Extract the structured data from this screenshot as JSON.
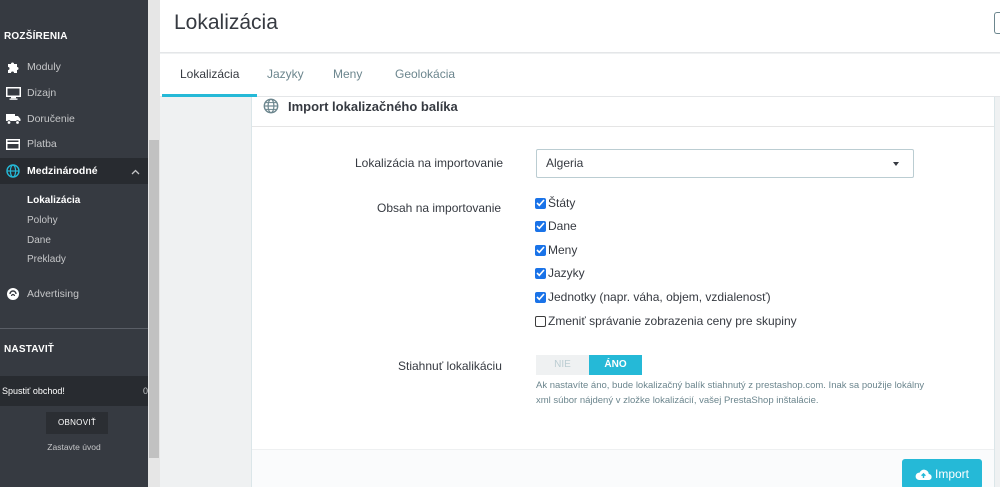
{
  "sidebar": {
    "section_extensions": "ROZŠÍRENIA",
    "items": [
      {
        "label": "Moduly",
        "icon": "puzzle-icon"
      },
      {
        "label": "Dizajn",
        "icon": "monitor-icon"
      },
      {
        "label": "Doručenie",
        "icon": "truck-icon"
      },
      {
        "label": "Platba",
        "icon": "credit-card-icon"
      },
      {
        "label": "Medzinárodné",
        "icon": "globe-icon"
      },
      {
        "label": "Advertising",
        "icon": "advertising-icon"
      }
    ],
    "subitems": [
      "Lokalizácia",
      "Polohy",
      "Dane",
      "Preklady"
    ],
    "section_settings": "NASTAVIŤ",
    "shop_label": "Spustiť obchod!",
    "shop_count": "0",
    "refresh_button": "OBNOVIŤ",
    "stop_tour": "Zastavte úvod"
  },
  "header": {
    "title": "Lokalizácia"
  },
  "tabs": [
    "Lokalizácia",
    "Jazyky",
    "Meny",
    "Geolokácia"
  ],
  "panel": {
    "title": "Import lokalizačného balíka",
    "localization_label": "Lokalizácia na importovanie",
    "localization_value": "Algeria",
    "content_label": "Obsah na importovanie",
    "content_options": [
      {
        "label": "Štáty",
        "checked": true
      },
      {
        "label": "Dane",
        "checked": true
      },
      {
        "label": "Meny",
        "checked": true
      },
      {
        "label": "Jazyky",
        "checked": true
      },
      {
        "label": "Jednotky (napr. váha, objem, vzdialenosť)",
        "checked": true
      },
      {
        "label": "Zmeniť správanie zobrazenia ceny pre skupiny",
        "checked": false
      }
    ],
    "download_label": "Stiahnuť lokalikáciu",
    "switch_no": "NIE",
    "switch_yes": "ÁNO",
    "switch_value": "ÁNO",
    "help_text": "Ak nastavíte áno, bude lokalizačný balík stiahnutý z prestashop.com. Inak sa použije lokálny xml súbor nájdený v zložke lokalizácií, vašej PrestaShop inštalácie.",
    "import_button": "Import"
  },
  "colors": {
    "accent": "#25b9d7",
    "sidebar_bg": "#363a41",
    "checkbox": "#1a73e8"
  }
}
